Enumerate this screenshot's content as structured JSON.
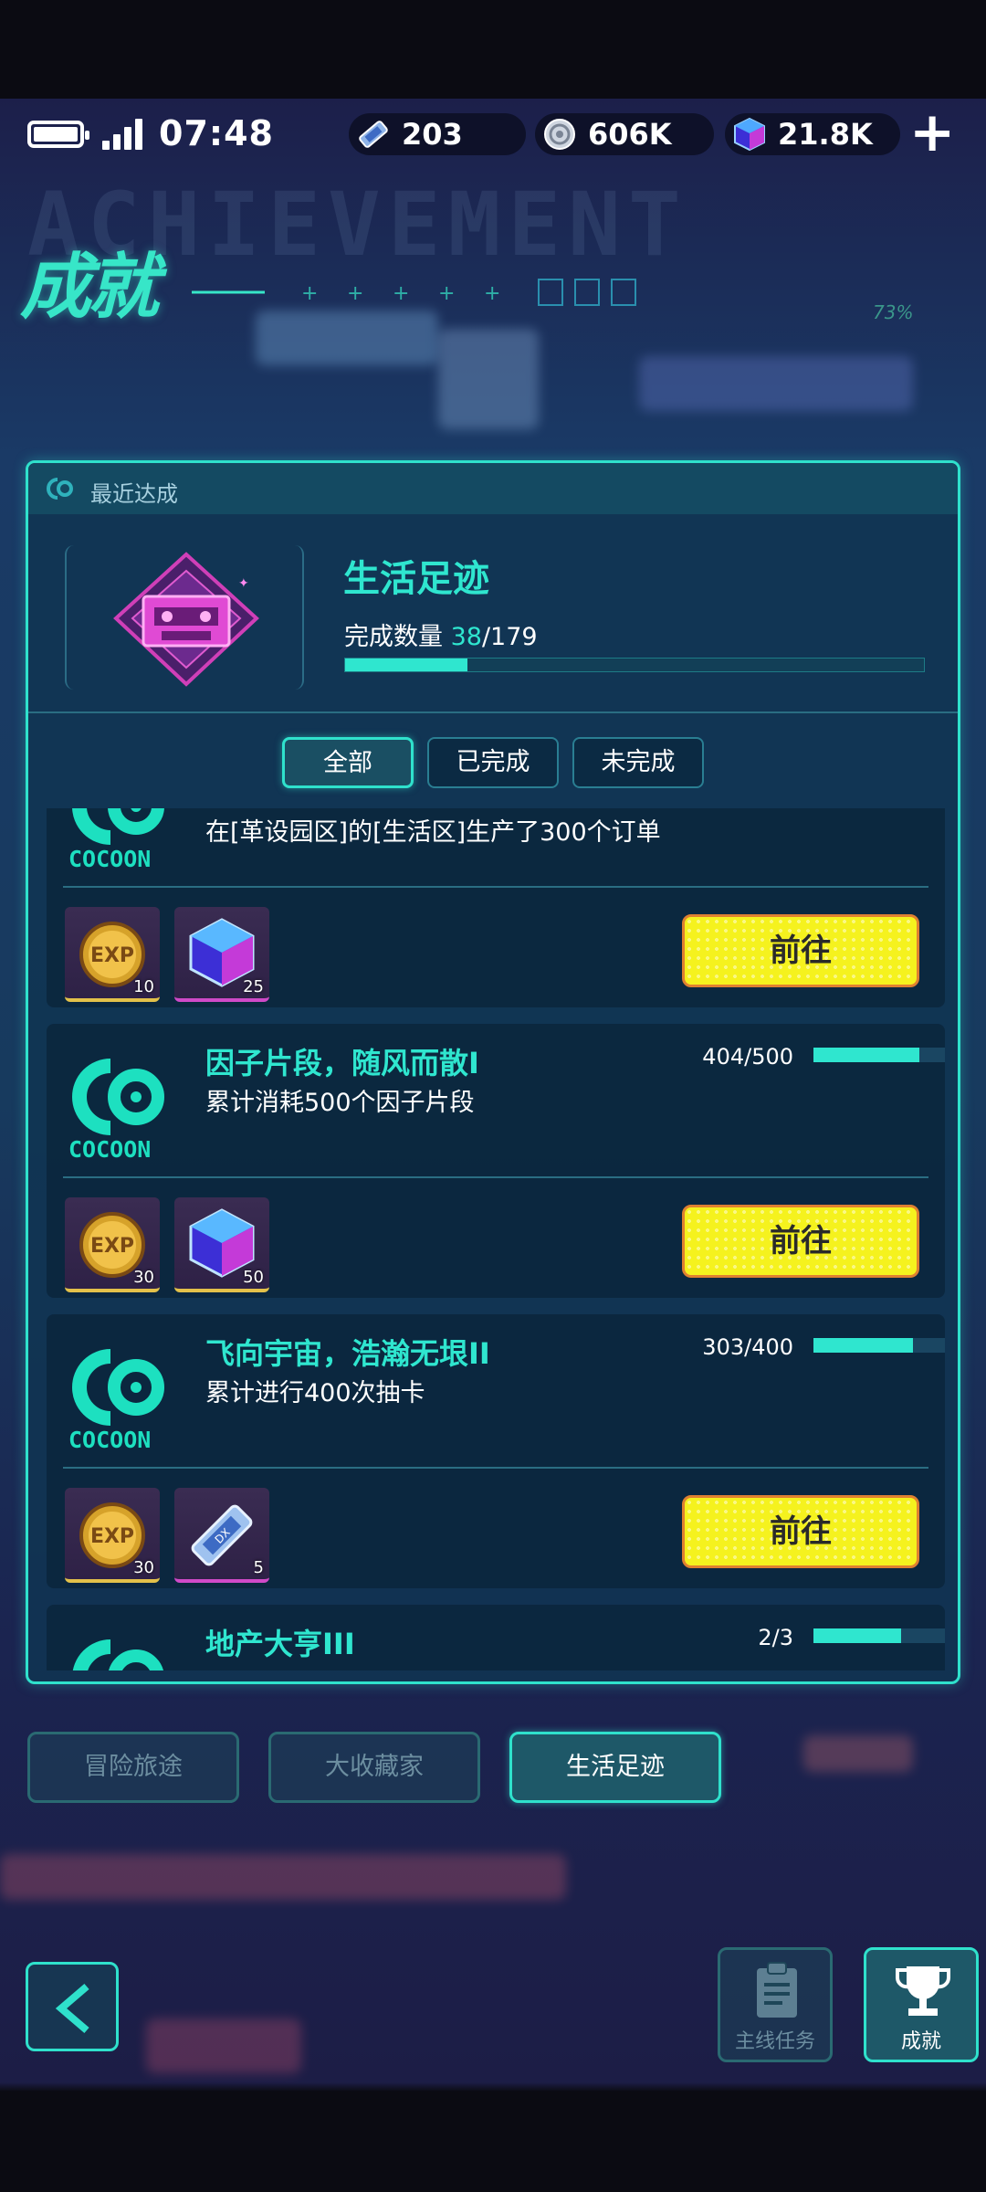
{
  "status": {
    "time": "07:48",
    "currencies": [
      {
        "icon": "ticket-icon",
        "value": "203"
      },
      {
        "icon": "coin-icon",
        "value": "606K"
      },
      {
        "icon": "gem-cube-icon",
        "value": "21.8K"
      }
    ]
  },
  "header": {
    "title": "成就",
    "progress_pct": "73%"
  },
  "recent": {
    "label": "最近达成",
    "category_name": "生活足迹",
    "count_label": "完成数量",
    "count_done": "38",
    "count_total": "/179",
    "progress_fraction": 0.212
  },
  "filters": [
    {
      "label": "全部",
      "active": true
    },
    {
      "label": "已完成",
      "active": false
    },
    {
      "label": "未完成",
      "active": false
    }
  ],
  "achievements": [
    {
      "title": "",
      "desc": "在[革设园区]的[生活区]生产了300个订单",
      "progress": "",
      "rewards": [
        {
          "icon": "exp-coin-icon",
          "qty": "10"
        },
        {
          "icon": "gem-cube-icon",
          "qty": "25"
        }
      ],
      "button": "前往"
    },
    {
      "title": "因子片段，随风而散I",
      "desc": "累计消耗500个因子片段",
      "progress": "404/500",
      "progress_fraction": 0.808,
      "rewards": [
        {
          "icon": "exp-coin-icon",
          "qty": "30"
        },
        {
          "icon": "gem-cube-icon",
          "qty": "50"
        }
      ],
      "button": "前往"
    },
    {
      "title": "飞向宇宙，浩瀚无垠II",
      "desc": "累计进行400次抽卡",
      "progress": "303/400",
      "progress_fraction": 0.7575,
      "rewards": [
        {
          "icon": "exp-coin-icon",
          "qty": "30"
        },
        {
          "icon": "ticket-icon",
          "qty": "5"
        }
      ],
      "button": "前往"
    },
    {
      "title": "地产大亨III",
      "desc": "",
      "progress": "2/3",
      "progress_fraction": 0.667,
      "rewards": [],
      "button": ""
    }
  ],
  "logo_text": "COCOON",
  "category_tabs": [
    {
      "label": "冒险旅途",
      "active": false
    },
    {
      "label": "大收藏家",
      "active": false
    },
    {
      "label": "生活足迹",
      "active": true
    }
  ],
  "bottom_nav": [
    {
      "label": "主线任务",
      "icon": "clipboard-icon",
      "active": false
    },
    {
      "label": "成就",
      "icon": "trophy-icon",
      "active": true
    }
  ],
  "colors": {
    "accent": "#2fe6cf",
    "go_button": "#f5f21e",
    "badge": "#d03fb8"
  }
}
